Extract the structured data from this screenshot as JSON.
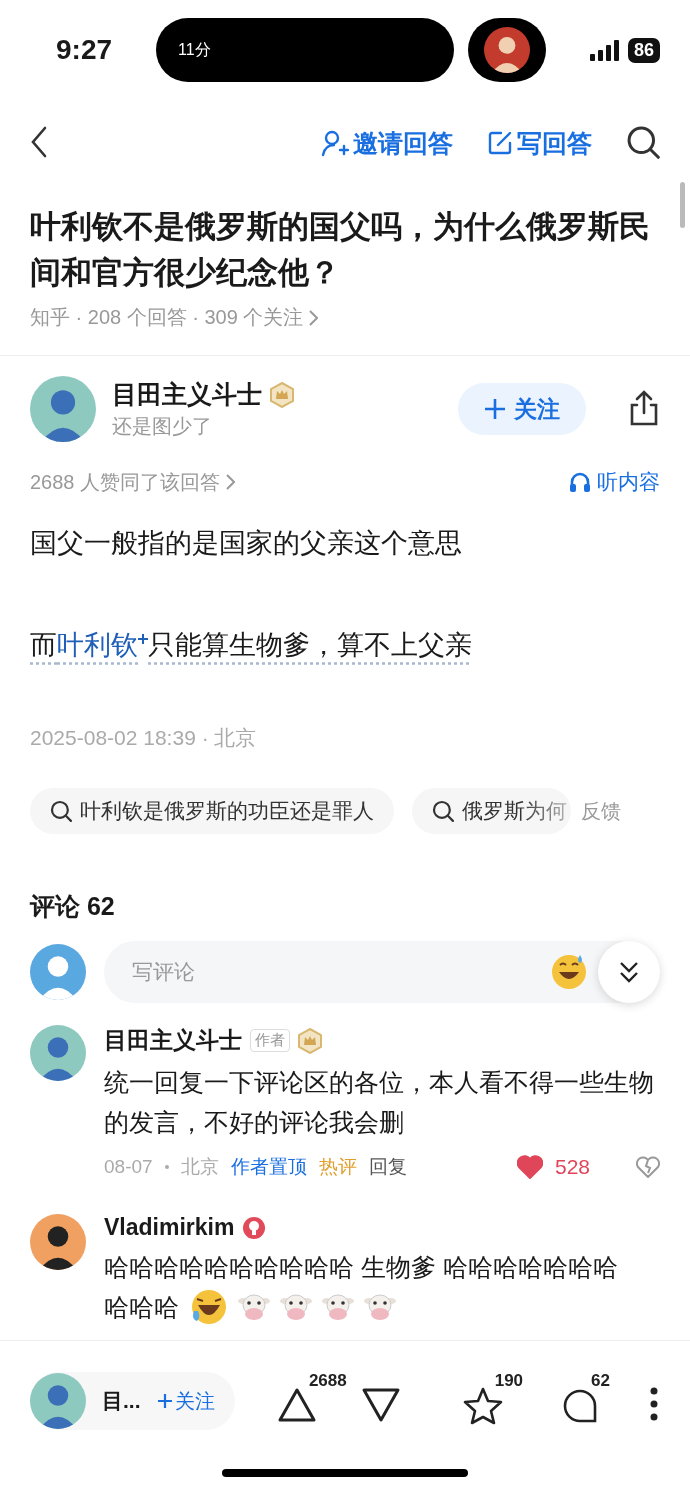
{
  "status_bar": {
    "time": "9:27",
    "island_text": "11分",
    "battery": "86"
  },
  "nav": {
    "actions": [
      {
        "kind": "invite",
        "label": "邀请回答"
      },
      {
        "kind": "write",
        "label": "写回答"
      }
    ]
  },
  "question": {
    "title": "叶利钦不是俄罗斯的国父吗，为什么俄罗斯民间和官方很少纪念他？",
    "meta": "知乎 · 208 个回答 · 309 个关注"
  },
  "answer": {
    "author": "目田主义斗士",
    "badge": {
      "kind": "crown"
    },
    "bio": "还是图少了",
    "follow_label": "关注",
    "upvote_summary": "2688 人赞同了该回答",
    "listen_label": "听内容",
    "paragraphs": [
      {
        "before": "国父一般指的是国家的父亲这个意思"
      },
      {
        "before": "而",
        "link": "叶利钦",
        "after": "只能算生物爹，算不上父亲"
      }
    ],
    "time": "2025-08-02 18:39 · 北京"
  },
  "related_searches": [
    {
      "text": "叶利钦是俄罗斯的功臣还是罪人",
      "faded": false
    },
    {
      "text": "俄罗斯为何",
      "faded": true
    }
  ],
  "feedback": "反馈",
  "comments_title": "评论 62",
  "comment_input": {
    "placeholder": "写评论"
  },
  "comments": [
    {
      "name": "目田主义斗士",
      "author_tag": "作者",
      "badge": {
        "kind": "crown"
      },
      "lines": [
        "统一回复一下评论区的各位，本人看不得一些生物的发言，不好的评论我会删"
      ],
      "date": "08-07",
      "location": "北京",
      "pinned": "作者置顶",
      "hot": "热评",
      "reply": "回复",
      "likes": "528",
      "liked": true
    },
    {
      "name": "Vladimirkim",
      "badge": {
        "kind": "medal"
      },
      "lines": [
        "哈哈哈哈哈哈哈哈哈哈  生物爹  哈哈哈哈哈哈哈",
        "哈哈哈"
      ],
      "emojis": [
        {
          "kind": "laugh"
        },
        {
          "kind": "cow"
        },
        {
          "kind": "cow"
        },
        {
          "kind": "cow"
        },
        {
          "kind": "cow"
        }
      ]
    }
  ],
  "bottom_bar": {
    "author": "目...",
    "follow_label": "关注",
    "upvotes": "2688",
    "favorites": "190",
    "comments": "62"
  }
}
